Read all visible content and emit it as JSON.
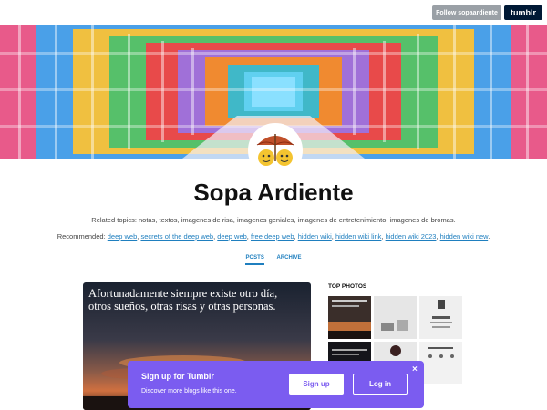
{
  "topbar": {
    "follow_label": "Follow sopaardiente",
    "logo_text": "tumblr"
  },
  "blog": {
    "title": "Sopa Ardiente",
    "related": "Related topics: notas, textos, imagenes de risa, imagenes geniales, imagenes de entretenimiento, imagenes de bromas.",
    "recommended_label": "Recommended:",
    "recommended_links": [
      "deep web",
      "secrets of the deep web",
      "deep web",
      "free deep web",
      "hidden wiki",
      "hidden wiki link",
      "hidden wiki 2023",
      "hidden wiki new"
    ]
  },
  "tabs": {
    "posts": "POSTS",
    "archive": "ARCHIVE"
  },
  "post": {
    "text": "Afortunadamente siempre existe otro día, otros sueños, otras risas y otras personas."
  },
  "top_photos": {
    "label": "TOP PHOTOS"
  },
  "signup_banner": {
    "title": "Sign up for Tumblr",
    "subtitle": "Discover more blogs like this one.",
    "signup_label": "Sign up",
    "login_label": "Log in",
    "close_label": "×"
  },
  "colors": {
    "accent": "#7b5cf0",
    "link": "#1f7fbf",
    "tumblr_navy": "#001935"
  }
}
